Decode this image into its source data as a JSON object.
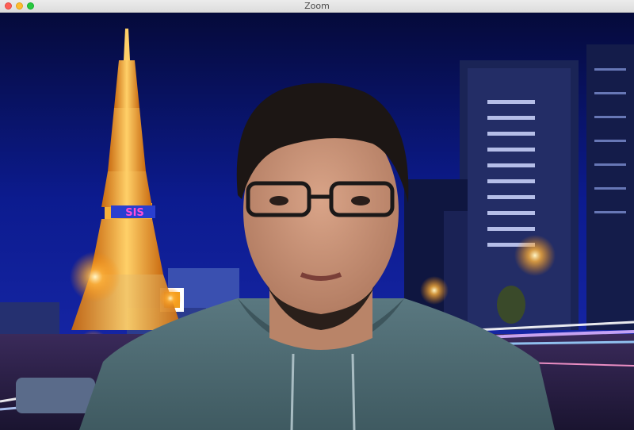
{
  "window": {
    "title": "Zoom",
    "controls": {
      "close": "close-icon",
      "minimize": "minimize-icon",
      "maximize": "maximize-icon"
    }
  },
  "colors": {
    "close": "#fe5f57",
    "minimize": "#febc2e",
    "maximize": "#28c840",
    "sky": "#0b1a8a",
    "tower": "#f2a52a",
    "hoodie": "#4f6c73"
  },
  "video": {
    "background": "virtual-background-city-night",
    "participant": "participant-video"
  },
  "signs": {
    "tower_sign": "SIS"
  }
}
